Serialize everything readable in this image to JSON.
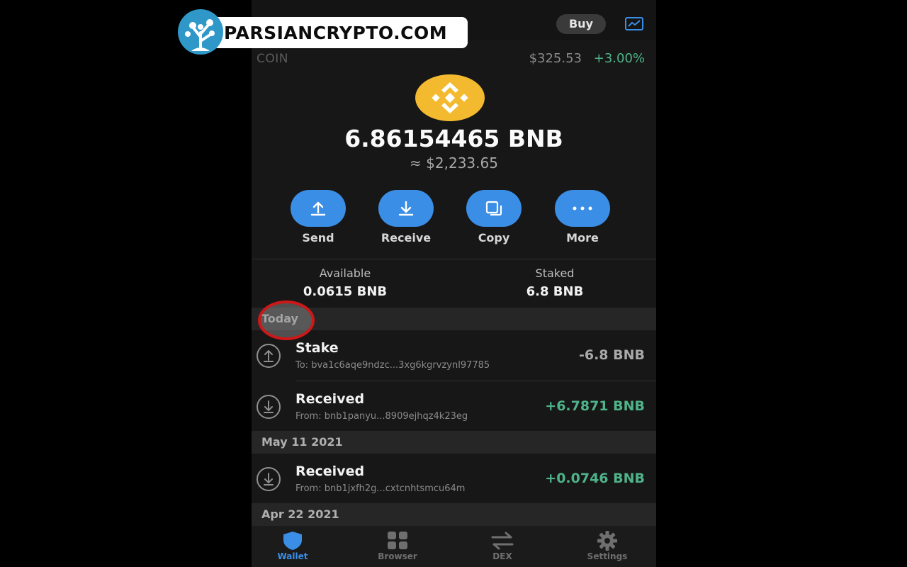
{
  "header": {
    "buy_label": "Buy"
  },
  "coin": {
    "label": "COIN",
    "price": "$325.53",
    "change": "+3.00%",
    "balance": "6.86154465 BNB",
    "fiat_value": "≈ $2,233.65"
  },
  "actions": [
    {
      "label": "Send",
      "icon": "upload-arrow-icon"
    },
    {
      "label": "Receive",
      "icon": "download-arrow-icon"
    },
    {
      "label": "Copy",
      "icon": "copy-icon"
    },
    {
      "label": "More",
      "icon": "more-dots-icon"
    }
  ],
  "stats": {
    "available_label": "Available",
    "available_value": "0.0615 BNB",
    "staked_label": "Staked",
    "staked_value": "6.8 BNB"
  },
  "sections": [
    {
      "date": "Today",
      "transactions": [
        {
          "title": "Stake",
          "subtitle": "To: bva1c6aqe9ndzc...3xg6kgrvzynl97785",
          "amount": "-6.8 BNB",
          "direction": "out"
        },
        {
          "title": "Received",
          "subtitle": "From: bnb1panyu...8909ejhqz4k23eg",
          "amount": "+6.7871 BNB",
          "direction": "in"
        }
      ]
    },
    {
      "date": "May 11 2021",
      "transactions": [
        {
          "title": "Received",
          "subtitle": "From: bnb1jxfh2g...cxtcnhtsmcu64m",
          "amount": "+0.0746 BNB",
          "direction": "in"
        }
      ]
    },
    {
      "date": "Apr 22 2021",
      "transactions": []
    }
  ],
  "tabs": [
    {
      "label": "Wallet",
      "icon": "shield-icon",
      "active": true
    },
    {
      "label": "Browser",
      "icon": "grid-icon",
      "active": false
    },
    {
      "label": "DEX",
      "icon": "swap-arrows-icon",
      "active": false
    },
    {
      "label": "Settings",
      "icon": "gear-icon",
      "active": false
    }
  ],
  "watermark": {
    "text": "PARSIANCRYPTO.COM"
  },
  "colors": {
    "accent_blue": "#3b8ee6",
    "positive_green": "#4fb38a",
    "bnb_yellow": "#f3ba2f",
    "highlight_red": "#cc1818"
  }
}
